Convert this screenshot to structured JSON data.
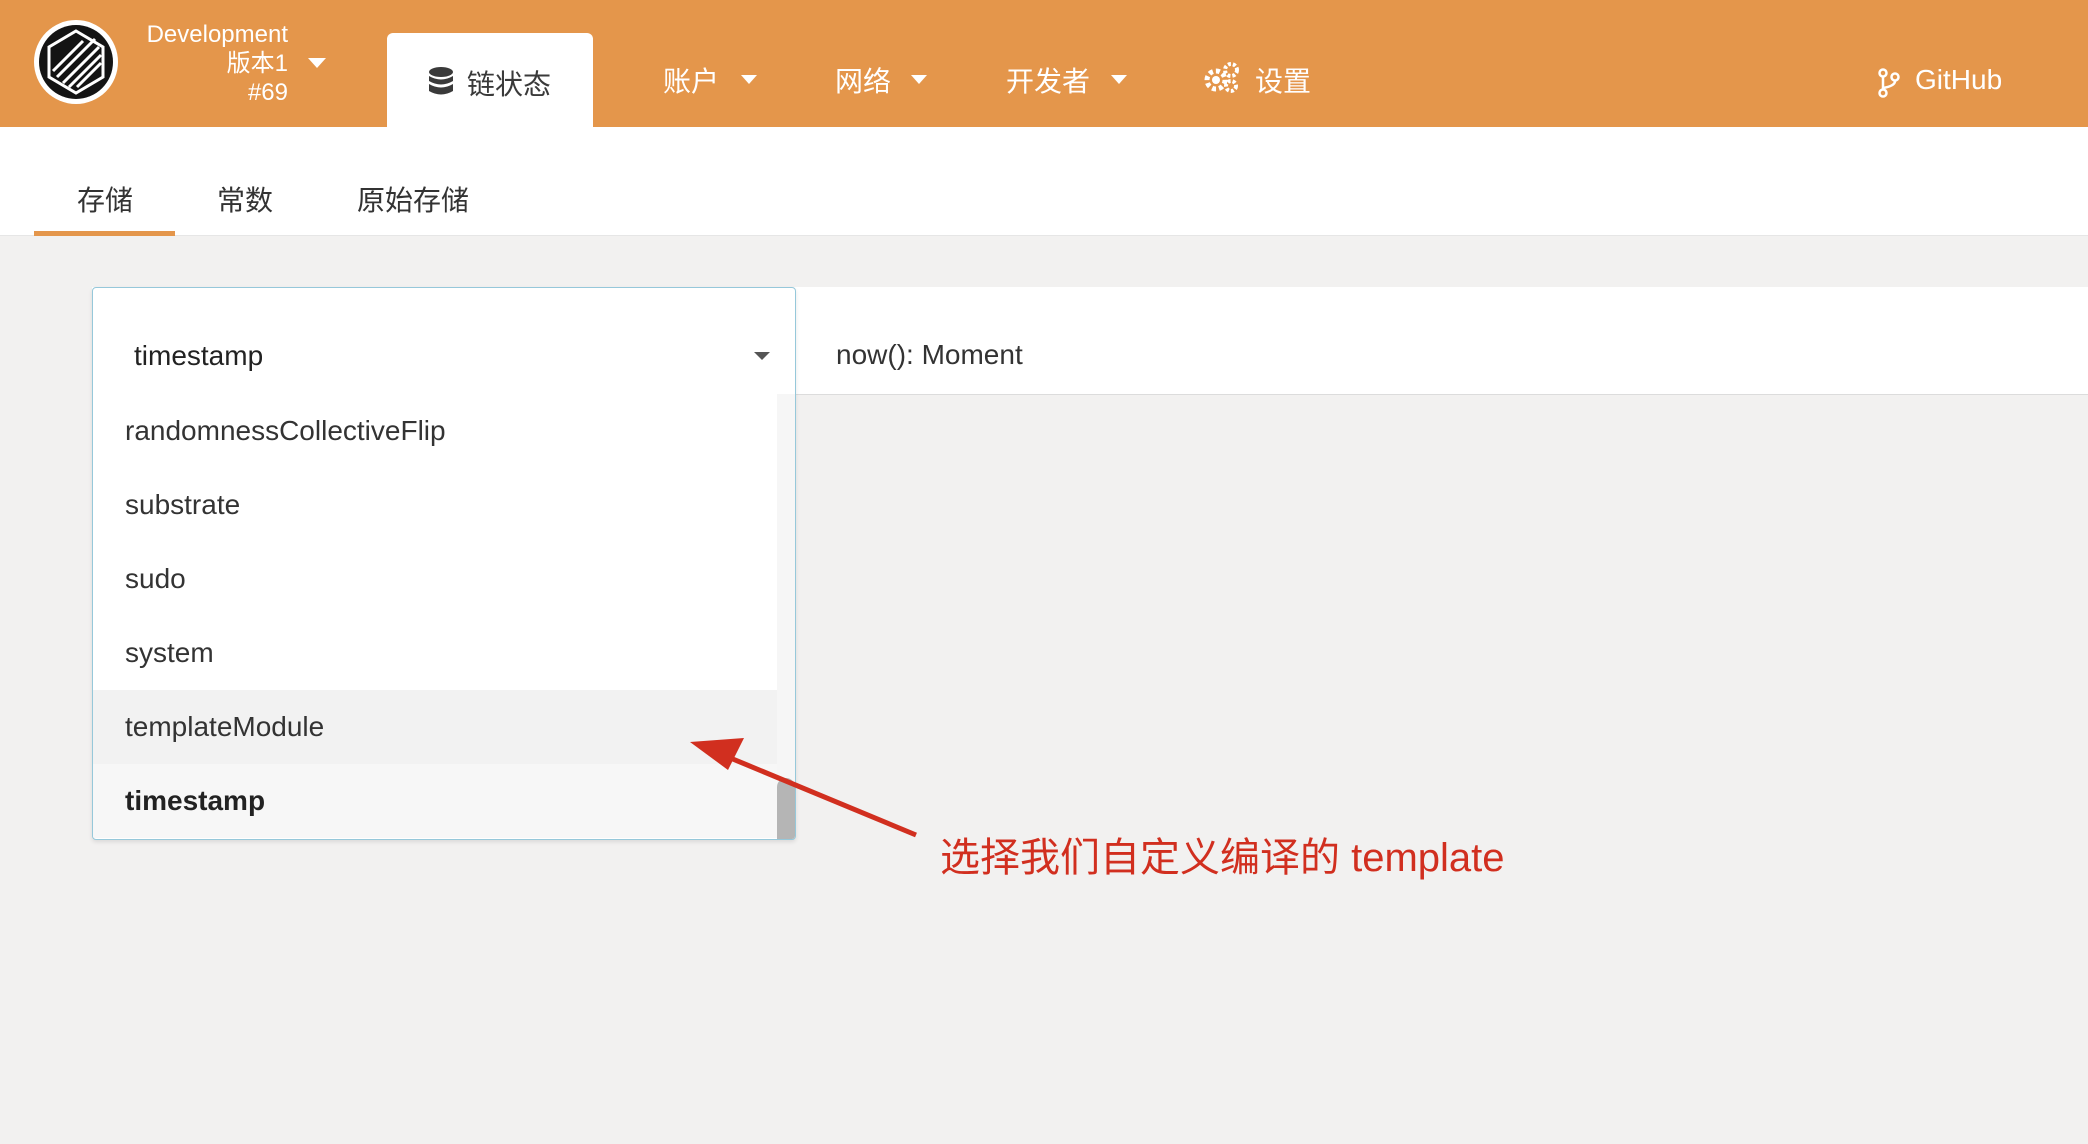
{
  "header": {
    "chain_name": "Development",
    "version": "版本1",
    "block": "#69",
    "nav_active_label": "链状态",
    "nav_items": [
      {
        "label": "账户"
      },
      {
        "label": "网络"
      },
      {
        "label": "开发者"
      },
      {
        "label": "设置"
      }
    ],
    "github_label": "GitHub",
    "accent_color": "#e4964b"
  },
  "subtabs": [
    {
      "label": "存储",
      "active": true
    },
    {
      "label": "常数",
      "active": false
    },
    {
      "label": "原始存储",
      "active": false
    }
  ],
  "storage": {
    "selected_module": "timestamp",
    "method": "now(): Moment",
    "options": [
      "randomnessCollectiveFlip",
      "substrate",
      "sudo",
      "system",
      "templateModule",
      "timestamp"
    ],
    "highlighted": "templateModule"
  },
  "annotation": {
    "text": "选择我们自定义编译的 template",
    "color": "#d12f1f"
  }
}
